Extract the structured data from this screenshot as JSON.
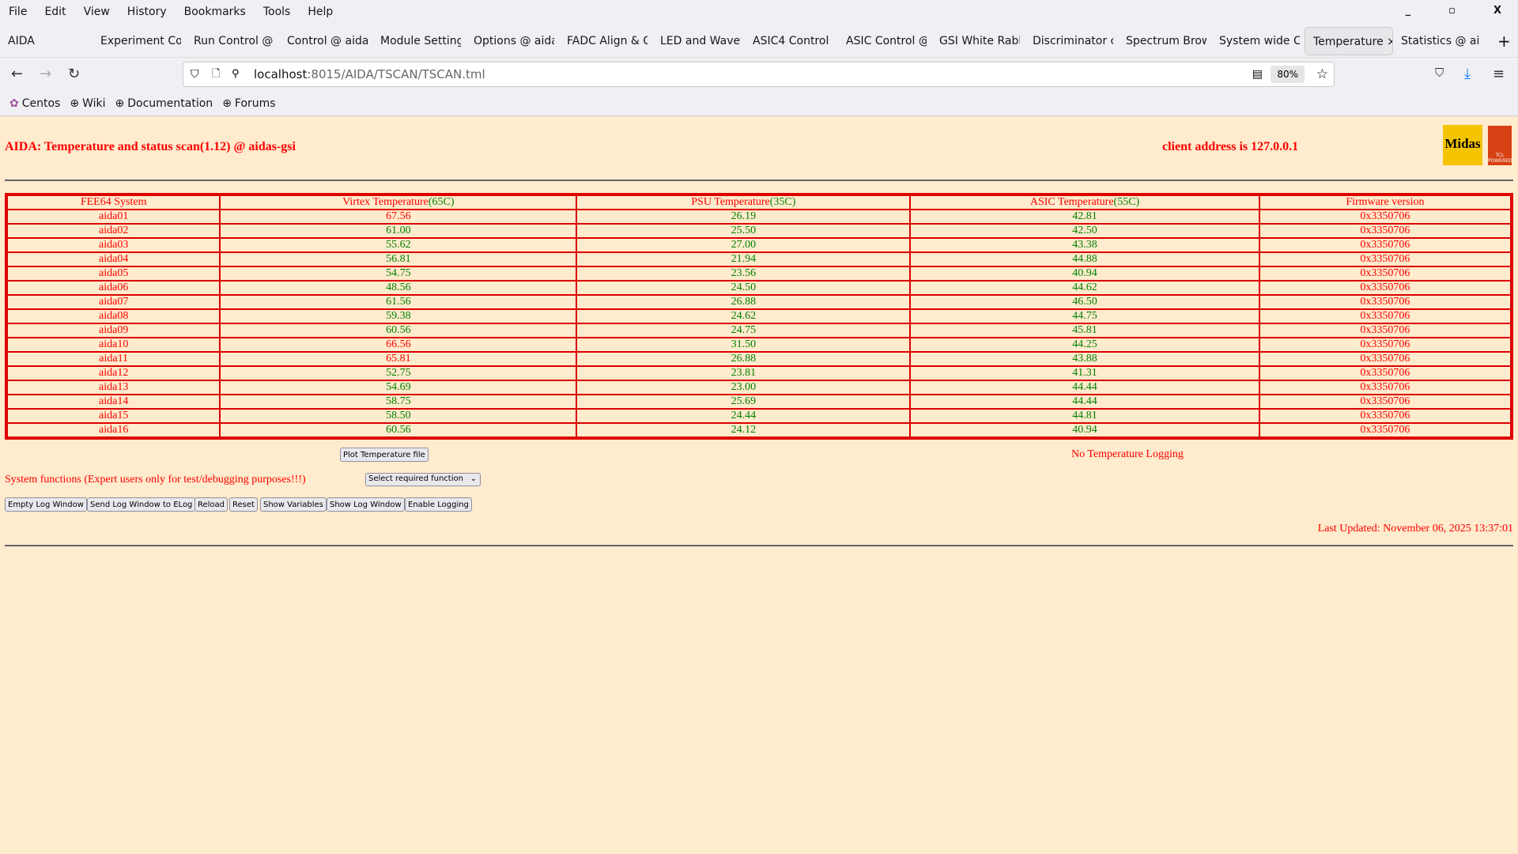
{
  "menu": [
    "File",
    "Edit",
    "View",
    "History",
    "Bookmarks",
    "Tools",
    "Help"
  ],
  "tabs": [
    "AIDA",
    "Experiment Co",
    "Run Control @",
    "Control @ aida",
    "Module Setting",
    "Options @ aida",
    "FADC Align & C",
    "LED and Wavef",
    "ASIC4 Control",
    "ASIC Control @",
    "GSI White Rabb",
    "Discriminator c",
    "Spectrum Brow",
    "System wide C",
    "Temperature",
    "Statistics @ ai"
  ],
  "active_tab": 14,
  "url": {
    "host": "localhost",
    "path": ":8015/AIDA/TSCAN/TSCAN.tml"
  },
  "zoom": "80%",
  "bookmarks": [
    "Centos",
    "Wiki",
    "Documentation",
    "Forums"
  ],
  "page": {
    "title": "AIDA: Temperature and status scan(1.12) @ aidas-gsi",
    "client": "client address is 127.0.0.1",
    "logo_text": "Midas",
    "logo2_text": "TCL POWERED"
  },
  "colors": {
    "over_limit": "#ff0000",
    "ok": "#008000",
    "border": "#dd0000",
    "background": "#ffebcd"
  },
  "table": {
    "headers": [
      {
        "text": "FEE64 System",
        "limit": ""
      },
      {
        "text": "Virtex Temperature",
        "limit": "(65C)"
      },
      {
        "text": "PSU Temperature",
        "limit": "(35C)"
      },
      {
        "text": "ASIC Temperature",
        "limit": "(55C)"
      },
      {
        "text": "Firmware version",
        "limit": ""
      }
    ],
    "limits": [
      null,
      65,
      35,
      55,
      null
    ],
    "rows": [
      [
        "aida01",
        "67.56",
        "26.19",
        "42.81",
        "0x3350706"
      ],
      [
        "aida02",
        "61.00",
        "25.50",
        "42.50",
        "0x3350706"
      ],
      [
        "aida03",
        "55.62",
        "27.00",
        "43.38",
        "0x3350706"
      ],
      [
        "aida04",
        "56.81",
        "21.94",
        "44.88",
        "0x3350706"
      ],
      [
        "aida05",
        "54.75",
        "23.56",
        "40.94",
        "0x3350706"
      ],
      [
        "aida06",
        "48.56",
        "24.50",
        "44.62",
        "0x3350706"
      ],
      [
        "aida07",
        "61.56",
        "26.88",
        "46.50",
        "0x3350706"
      ],
      [
        "aida08",
        "59.38",
        "24.62",
        "44.75",
        "0x3350706"
      ],
      [
        "aida09",
        "60.56",
        "24.75",
        "45.81",
        "0x3350706"
      ],
      [
        "aida10",
        "66.56",
        "31.50",
        "44.25",
        "0x3350706"
      ],
      [
        "aida11",
        "65.81",
        "26.88",
        "43.88",
        "0x3350706"
      ],
      [
        "aida12",
        "52.75",
        "23.81",
        "41.31",
        "0x3350706"
      ],
      [
        "aida13",
        "54.69",
        "23.00",
        "44.44",
        "0x3350706"
      ],
      [
        "aida14",
        "58.75",
        "25.69",
        "44.44",
        "0x3350706"
      ],
      [
        "aida15",
        "58.50",
        "24.44",
        "44.81",
        "0x3350706"
      ],
      [
        "aida16",
        "60.56",
        "24.12",
        "40.94",
        "0x3350706"
      ]
    ]
  },
  "plot_button": "Plot Temperature file",
  "no_logging": "No Temperature Logging",
  "system_functions": "System functions (Expert users only for test/debugging purposes!!!)",
  "select_value": "Select required function",
  "buttons": [
    "Empty Log Window",
    "Send Log Window to ELog",
    "Reload",
    "Reset",
    "Show Variables",
    "Show Log Window",
    "Enable Logging"
  ],
  "last_updated": "Last Updated: November 06, 2025 13:37:01"
}
